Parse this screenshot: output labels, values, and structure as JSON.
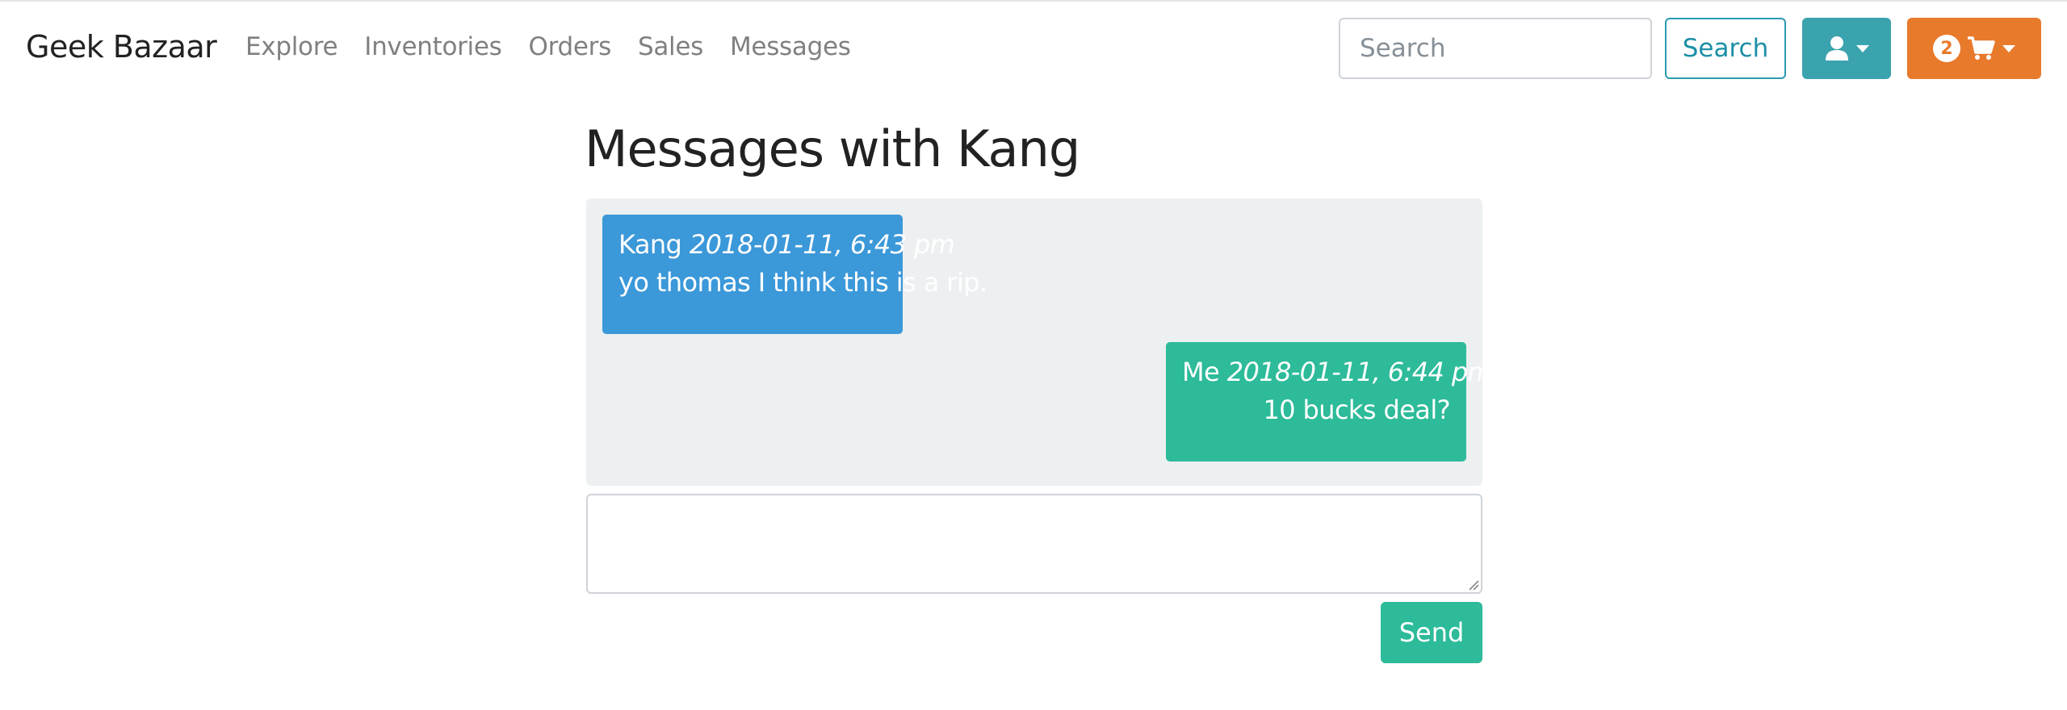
{
  "nav": {
    "brand": "Geek Bazaar",
    "links": [
      "Explore",
      "Inventories",
      "Orders",
      "Sales",
      "Messages"
    ],
    "search_placeholder": "Search",
    "search_button": "Search",
    "user_icon": "user-icon",
    "cart_icon": "cart-icon",
    "cart_count": "2"
  },
  "page": {
    "title": "Messages with Kang"
  },
  "messages": [
    {
      "sender": "Kang",
      "time": "2018-01-11, 6:43 pm",
      "text": "yo thomas I think this is a rip.",
      "direction": "incoming"
    },
    {
      "sender": "Me",
      "time": "2018-01-11, 6:44 pm",
      "text": "10 bucks deal?",
      "direction": "outgoing"
    }
  ],
  "composer": {
    "value": "",
    "send_label": "Send"
  },
  "colors": {
    "incoming": "#3b98d9",
    "outgoing": "#2dbb9a",
    "cart": "#e87a2c",
    "user": "#3aa3ae",
    "thread_bg": "#ecf0f1"
  }
}
